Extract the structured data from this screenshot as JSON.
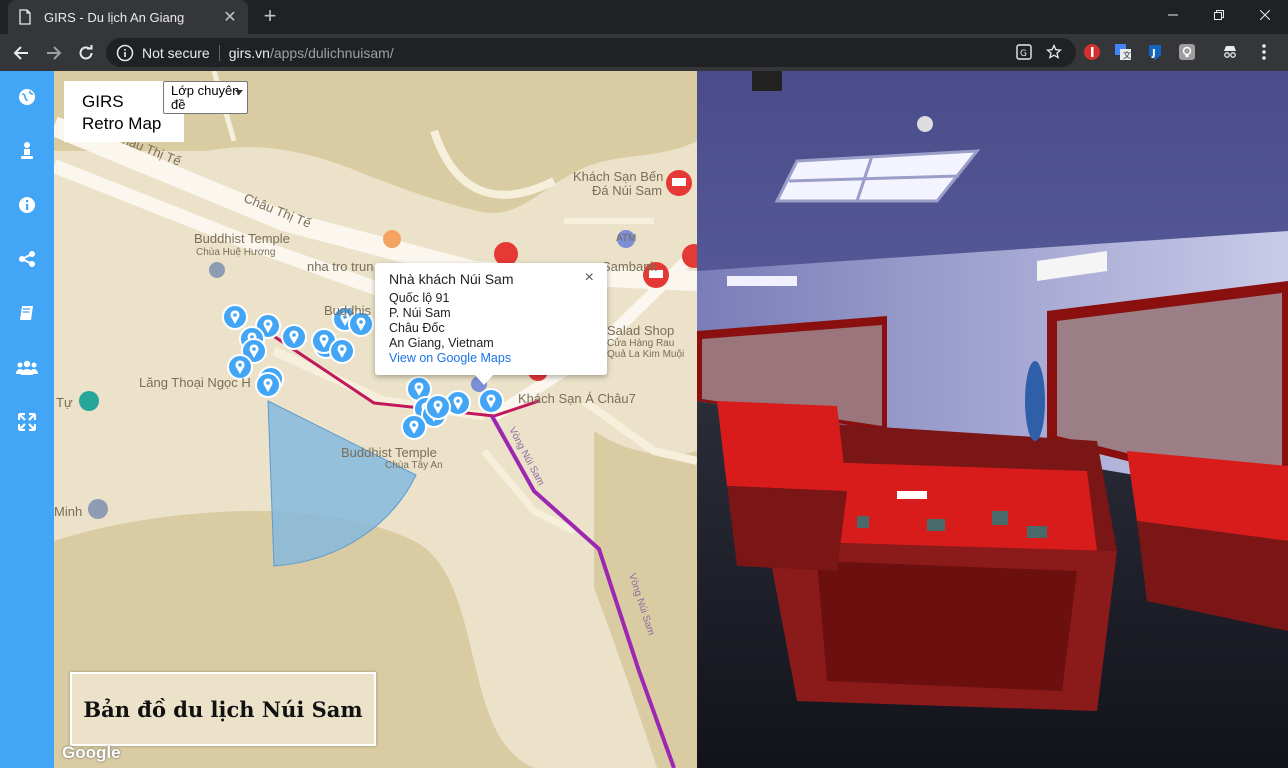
{
  "browser": {
    "tab_title": "GIRS - Du lịch An Giang",
    "url_security": "Not secure",
    "url_host": "girs.vn",
    "url_path": "/apps/dulichnuisam/"
  },
  "map": {
    "logo_text": "GIRS\nRetro Map",
    "layer_select": "Lớp chuyên đề",
    "labels": {
      "road1": "Châu Thị Tế",
      "road2": "Châu Thị Tế",
      "temple1": "Buddhist Temple",
      "temple1_sub": "Chùa Huệ Hương",
      "nhatro": "nha tro trun",
      "buddhist_partial": "Buddhis",
      "hotel1": "Khách Sạn Bến",
      "hotel1b": "Đá Núi Sam",
      "salad": "Salad Shop",
      "salad_sub1": "Cửa Hàng Rau",
      "salad_sub2": "Quả La Kim Muội",
      "sambank": "Sambank",
      "atm": "ATM",
      "lang": "Lăng Thoại Ngọc H",
      "tu": "Tự",
      "temple2": "Buddhist Temple",
      "temple2_sub": "Chùa Tây An",
      "hotel2": "Khách Sạn Á Châu7",
      "minh": "Minh",
      "road_vertical": "Vòng Núi Sam",
      "google": "Google"
    },
    "popup": {
      "title": "Nhà khách Núi Sam",
      "line1": "Quốc lộ 91",
      "line2": "P. Núi Sam",
      "line3": "Châu Đốc",
      "line4": "An Giang, Vietnam",
      "link": "View on Google Maps",
      "close": "×"
    },
    "title_box": "Bản đồ du lịch Núi Sam"
  },
  "sidebar": {
    "items": [
      "globe-icon",
      "person-icon",
      "info-icon",
      "share-icon",
      "book-icon",
      "group-icon",
      "fullscreen-icon"
    ]
  },
  "colors": {
    "sidebar": "#42a5f5",
    "marker": "#42a5f5",
    "route_main": "#9c27b0",
    "route_local": "#c2185b",
    "polygon": "#7fb8e0"
  }
}
